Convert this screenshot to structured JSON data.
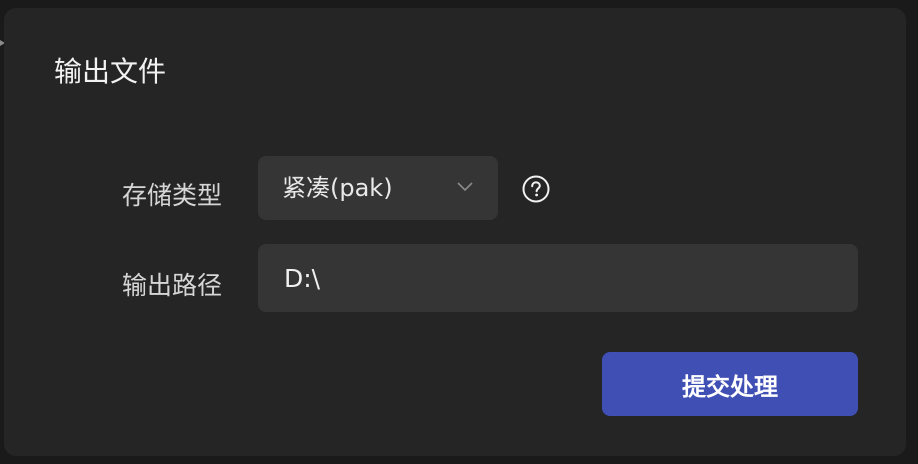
{
  "dialog": {
    "title": "输出文件"
  },
  "storage": {
    "label": "存储类型",
    "selected": "紧凑(pak)"
  },
  "output": {
    "label": "输出路径",
    "value": "D:\\"
  },
  "actions": {
    "submit_label": "提交处理"
  },
  "icons": {
    "dropdown": "chevron-down-icon",
    "help": "help-circle-icon"
  },
  "colors": {
    "background": "#1a1a1a",
    "panel": "#252525",
    "field": "#353535",
    "primary": "#3f4fb4"
  }
}
